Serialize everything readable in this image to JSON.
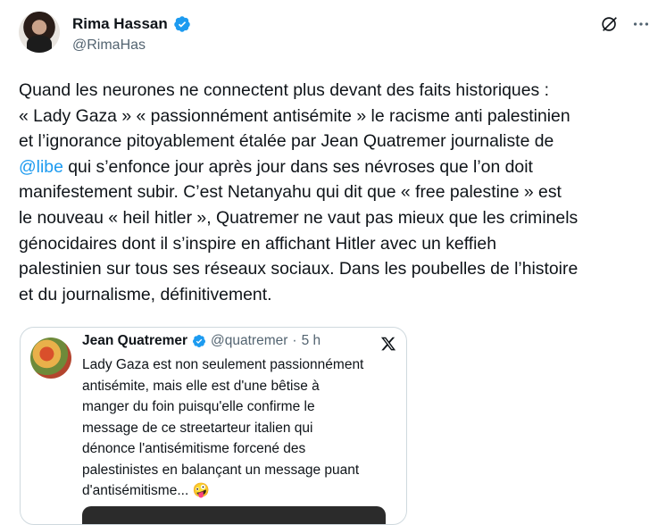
{
  "author": {
    "name": "Rima Hassan",
    "handle": "@RimaHas",
    "verified": true,
    "avatar_icon": "profile-photo"
  },
  "actions": {
    "grok_icon": "grok-icon",
    "more_icon": "more-icon"
  },
  "tweet": {
    "text_before_mention": "Quand les neurones ne connectent plus devant des faits historiques :\n« Lady Gaza » « passionnément antisémite » le racisme anti palestinien\net l’ignorance pitoyablement étalée par Jean Quatremer journaliste de\n",
    "mention": "@libe",
    "text_after_mention": " qui s’enfonce jour après jour dans ses névroses que l’on doit\nmanifestement subir. C’est Netanyahu qui dit que « free palestine » est\nle nouveau « heil hitler », Quatremer ne vaut pas mieux que les criminels\ngénocidaires dont il s’inspire en affichant Hitler avec un keffieh\npalestinien sur tous ses réseaux sociaux. Dans les poubelles de l’histoire\net du journalisme, définitivement."
  },
  "quoted": {
    "name": "Jean Quatremer",
    "handle": "@quatremer",
    "separator": "·",
    "time": "5 h",
    "verified": true,
    "text": "Lady Gaza est non seulement passionnément\nantisémite, mais elle est d'une bêtise à\nmanger du foin puisqu'elle confirme le\nmessage de ce streetarteur italien qui\ndénonce l'antisémitisme forcené  des\npalestinistes en balançant un message puant\nd'antisémitisme... 🤪",
    "platform_icon": "x-logo-icon"
  },
  "colors": {
    "text": "#0f1419",
    "secondary": "#536471",
    "link": "#1d9bf0",
    "border": "#cfd9de"
  }
}
